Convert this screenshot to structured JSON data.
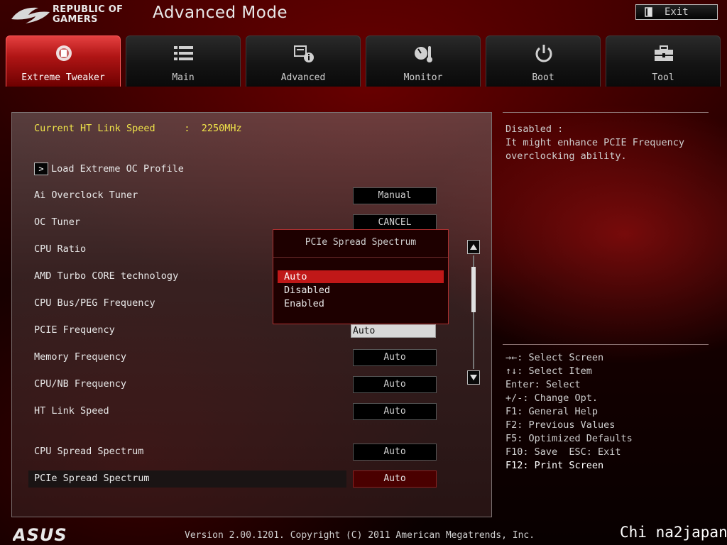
{
  "header": {
    "brand_line1": "REPUBLIC OF",
    "brand_line2": "GAMERS",
    "mode_title": "Advanced Mode",
    "exit_label": "Exit"
  },
  "tabs": [
    {
      "label": "Extreme Tweaker",
      "icon": "tweaker-icon",
      "active": true
    },
    {
      "label": "Main",
      "icon": "list-icon",
      "active": false
    },
    {
      "label": "Advanced",
      "icon": "advanced-icon",
      "active": false
    },
    {
      "label": "Monitor",
      "icon": "monitor-icon",
      "active": false
    },
    {
      "label": "Boot",
      "icon": "power-icon",
      "active": false
    },
    {
      "label": "Tool",
      "icon": "tool-icon",
      "active": false
    }
  ],
  "settings": {
    "ht_link_speed": "Current HT Link Speed     :  2250MHz",
    "load_profile": "Load Extreme OC Profile",
    "ai_overclock_tuner": {
      "label": "Ai Overclock Tuner",
      "value": "Manual"
    },
    "oc_tuner": {
      "label": "OC Tuner",
      "value": "CANCEL"
    },
    "cpu_ratio": {
      "label": "CPU Ratio"
    },
    "amd_turbo": {
      "label": "AMD Turbo CORE technology"
    },
    "cpu_bus": {
      "label": "CPU Bus/PEG Frequency"
    },
    "pcie_freq": {
      "label": "PCIE Frequency",
      "value": "Auto"
    },
    "mem_freq": {
      "label": "Memory Frequency",
      "value": "Auto"
    },
    "cpunb_freq": {
      "label": "CPU/NB Frequency",
      "value": "Auto"
    },
    "ht_link": {
      "label": "HT Link Speed",
      "value": "Auto"
    },
    "cpu_spread": {
      "label": "CPU Spread Spectrum",
      "value": "Auto"
    },
    "pcie_spread": {
      "label": "PCIe Spread Spectrum",
      "value": "Auto"
    }
  },
  "popup": {
    "title": "PCIe Spread Spectrum",
    "options": [
      "Auto",
      "Disabled",
      "Enabled"
    ],
    "selected": "Auto"
  },
  "help": {
    "text": "Disabled :\nIt might enhance PCIE Frequency\noverclocking ability."
  },
  "keys": [
    "→←: Select Screen",
    "↑↓: Select Item",
    "Enter: Select",
    "+/-: Change Opt.",
    "F1: General Help",
    "F2: Previous Values",
    "F5: Optimized Defaults",
    "F10: Save  ESC: Exit",
    "F12: Print Screen"
  ],
  "footer": {
    "version": "Version 2.00.1201. Copyright (C) 2011 American Megatrends, Inc.",
    "watermark": "Chi na2japan"
  },
  "colors": {
    "accent_red": "#c01818",
    "highlight_yellow": "#f0e44a"
  }
}
